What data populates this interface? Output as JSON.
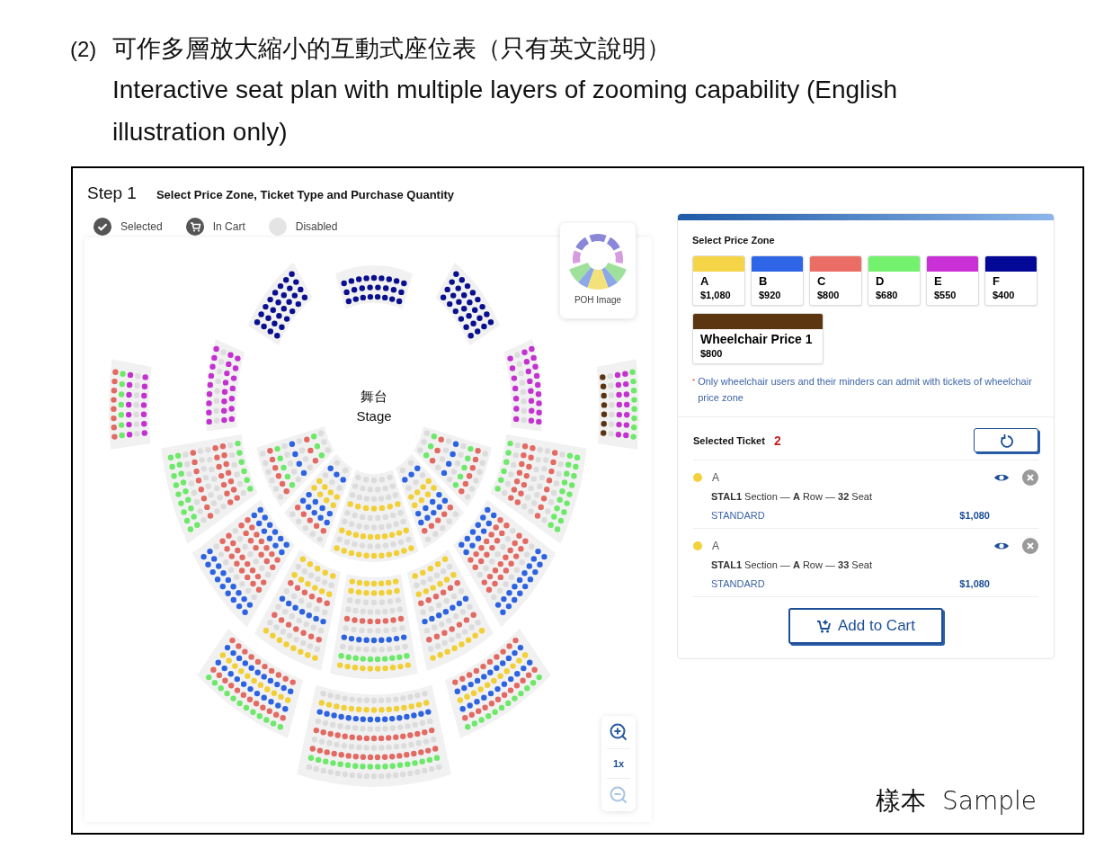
{
  "caption": {
    "number": "(2)",
    "title_zh": "可作多層放大縮小的互動式座位表（只有英文說明）",
    "title_en": "Interactive seat plan with multiple layers of zooming capability (English illustration only)"
  },
  "step": {
    "label": "Step 1",
    "title": "Select Price Zone, Ticket Type and Purchase Quantity"
  },
  "legend": [
    {
      "kind": "selected",
      "label": "Selected"
    },
    {
      "kind": "in_cart",
      "label": "In Cart"
    },
    {
      "kind": "disabled",
      "label": "Disabled"
    }
  ],
  "seat_map": {
    "stage_zh": "舞台",
    "stage_en": "Stage",
    "thumbnail_label": "POH Image",
    "zoom_level": "1x",
    "zoom_out_disabled": true
  },
  "price_panel": {
    "title": "Select Price Zone",
    "zones": [
      {
        "kind": "standard",
        "name": "A",
        "price": "$1,080",
        "color": "#f5d547"
      },
      {
        "kind": "standard",
        "name": "B",
        "price": "$920",
        "color": "#2f66e8"
      },
      {
        "kind": "standard",
        "name": "C",
        "price": "$800",
        "color": "#ea6e66"
      },
      {
        "kind": "standard",
        "name": "D",
        "price": "$680",
        "color": "#74f26e"
      },
      {
        "kind": "standard",
        "name": "E",
        "price": "$550",
        "color": "#c930d6"
      },
      {
        "kind": "standard",
        "name": "F",
        "price": "$400",
        "color": "#030897"
      },
      {
        "kind": "wheelchair",
        "name": "Wheelchair Price 1",
        "price": "$800",
        "color": "#5c3511"
      }
    ],
    "note_mark": "*",
    "note": "Only wheelchair users and their minders can admit with tickets of wheelchair price zone"
  },
  "selected_tickets": {
    "title": "Selected Ticket",
    "count": "2",
    "tickets": [
      {
        "zone": "A",
        "color": "#f2d13c",
        "seat": "**STAL1** Section — **A** Row — **32** Seat",
        "type": "STANDARD",
        "price": "$1,080"
      },
      {
        "zone": "A",
        "color": "#f2d13c",
        "seat": "**STAL1** Section — **A** Row — **33** Seat",
        "type": "STANDARD",
        "price": "$1,080"
      }
    ],
    "add_to_cart": "Add to Cart"
  },
  "stamp": "樣本  Sample"
}
